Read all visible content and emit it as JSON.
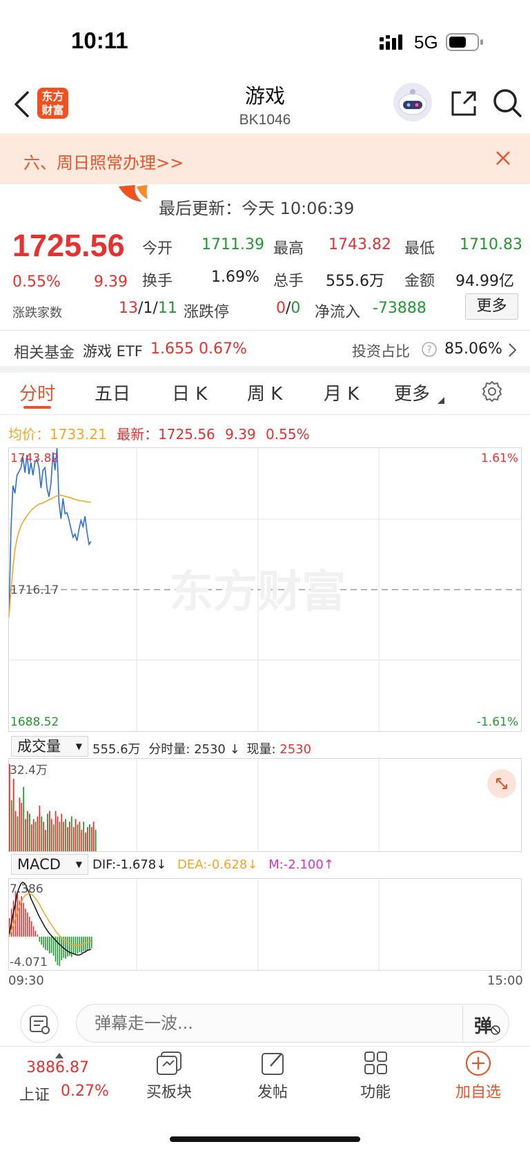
{
  "status_bar": {
    "time": "10:11",
    "network": "5G"
  },
  "header": {
    "logo_line1": "东方",
    "logo_line2": "财富",
    "title": "游戏",
    "code": "BK1046"
  },
  "notice": {
    "text": "六、周日照常办理>>"
  },
  "update": {
    "text": "最后更新：今天 10:06:39"
  },
  "quote": {
    "price": "1725.56",
    "change_pct": "0.55%",
    "change": "9.39",
    "open_label": "今开",
    "open": "1711.39",
    "high_label": "最高",
    "high": "1743.82",
    "low_label": "最低",
    "low": "1710.83",
    "turnover_label": "换手",
    "turnover": "1.69%",
    "volume_label": "总手",
    "volume": "555.6万",
    "amount_label": "金额",
    "amount": "94.99亿",
    "adv_label": "涨跌家数",
    "adv_up": "13",
    "adv_flat": "1",
    "adv_down": "11",
    "slash": "/",
    "limit_label": "涨跌停",
    "limit_up": "0",
    "limit_down": "0",
    "netflow_label": "净流入",
    "netflow": "-73888",
    "more_label": "更多"
  },
  "fund": {
    "label": "相关基金",
    "name": "游戏 ETF",
    "price": "1.655",
    "pct": "0.67%",
    "ratio_label": "投资占比",
    "ratio": "85.06%"
  },
  "tabs": [
    {
      "label": "分时"
    },
    {
      "label": "五日"
    },
    {
      "label": "日 K"
    },
    {
      "label": "周 K"
    },
    {
      "label": "月 K"
    },
    {
      "label": "更多"
    }
  ],
  "intraday": {
    "avg_label": "均价：",
    "avg": "1733.21",
    "latest_label": "最新：",
    "latest": "1725.56",
    "latest_chg": "9.39",
    "latest_pct": "0.55%",
    "y_top": "1743.82",
    "y_mid": "1716.17",
    "y_bottom": "1688.52",
    "pct_top": "1.61%",
    "pct_bottom": "-1.61%",
    "watermark": "东方财富"
  },
  "volume_panel": {
    "select": "成交量",
    "total": "555.6万",
    "min_label": "分时量:",
    "min_value": "2530",
    "now_label": "现量:",
    "now_value": "2530",
    "y_max": "32.4万"
  },
  "macd_panel": {
    "select": "MACD",
    "dif": "DIF:-1.678",
    "dea": "DEA:-0.628",
    "m": "M:-2.100",
    "y_max": "7.386",
    "y_min": "-4.071",
    "t_start": "09:30",
    "t_end": "15:00"
  },
  "comment": {
    "placeholder": "弹幕走一波...",
    "danmu_button": "弹"
  },
  "bottom_nav": {
    "index_value": "3886.87",
    "index_name": "上证",
    "index_pct": "0.27%",
    "items": [
      {
        "label": "买板块"
      },
      {
        "label": "发帖"
      },
      {
        "label": "功能"
      },
      {
        "label": "加自选"
      }
    ]
  },
  "colors": {
    "accent": "#e8552b",
    "up": "#e8312f",
    "down": "#1e9b2f",
    "price_line": "#2a6ed6",
    "avg_line": "#f5a623"
  },
  "chart_data": [
    {
      "type": "line",
      "title": "",
      "ylim": [
        1688.52,
        1743.82
      ],
      "series": [
        {
          "values": [
            1710.8,
            1728,
            1736.5,
            1735,
            1738.5,
            1739.2,
            1740,
            1742,
            1739,
            1742.5,
            1738.7,
            1741,
            1738.5,
            1741.2,
            1741.6,
            1740,
            1736,
            1739.5,
            1740,
            1736,
            1734.3,
            1737,
            1743,
            1739.5,
            1743.8,
            1733.2,
            1730,
            1734,
            1731,
            1731.2,
            1729.8,
            1728,
            1726.4,
            1727,
            1725.7,
            1728,
            1729.7,
            1728.5,
            1730.5,
            1727.4,
            1725,
            1725.6
          ]
        },
        {
          "values": [
            1710.8,
            1716,
            1720.5,
            1724,
            1726,
            1727.5,
            1728.6,
            1729.4,
            1730,
            1730.6,
            1731.1,
            1731.6,
            1732,
            1732.3,
            1732.6,
            1732.9,
            1733,
            1733.1,
            1733.3,
            1733.5,
            1733.7,
            1733.9,
            1734.1,
            1734.3,
            1734.5,
            1734.6,
            1734.6,
            1734.5,
            1734.4,
            1734.3,
            1734.2,
            1734.1,
            1733.9,
            1733.8,
            1733.7,
            1733.6,
            1733.5,
            1733.5,
            1733.4,
            1733.3,
            1733.3,
            1733.2
          ]
        }
      ]
    },
    {
      "type": "bar",
      "title": "",
      "ylim": [
        0,
        32.4
      ],
      "series": [
        {
          "values": [
            32.4,
            19,
            27,
            15,
            13,
            20,
            18,
            24,
            12,
            15,
            14,
            10,
            12,
            11,
            13,
            17,
            13,
            11,
            8,
            14,
            15,
            12,
            10,
            15,
            13,
            11,
            14,
            11,
            12,
            9,
            11,
            13,
            9,
            12,
            10,
            11,
            8,
            11,
            7,
            9,
            10,
            9,
            11,
            8
          ]
        }
      ]
    },
    {
      "type": "bar",
      "title": "",
      "ylim": [
        -4.071,
        7.386
      ],
      "series": [
        {
          "values": [
            2.5,
            3.8,
            4.9,
            6.2,
            5.8,
            4.9,
            5.5,
            4.6,
            3.8,
            3.3,
            2.7,
            2.1,
            1.4,
            0.8,
            0.3,
            -0.7,
            -1.1,
            -1.5,
            -1.8,
            -1.9,
            -2.3,
            -2.2,
            -2.6,
            -3.4,
            -3.9,
            -4.0,
            -3.2,
            -2.9,
            -3.0,
            -2.7,
            -2.6,
            -2.8,
            -2.4,
            -2.4,
            -2.3,
            -2.1,
            -2.2,
            -2.0,
            -2.0,
            -1.9,
            -1.7,
            -1.6
          ]
        },
        {
          "values": [
            0.2,
            1.5,
            3,
            4.2,
            5.8,
            6.6,
            7.2,
            7.4,
            7.2,
            6.6,
            6,
            5.2,
            4.6,
            4,
            3.4,
            2.8,
            2.3,
            1.8,
            1.3,
            0.9,
            0.5,
            0.2,
            -0.1,
            -0.4,
            -0.7,
            -1.0,
            -1.2,
            -1.5,
            -1.7,
            -1.9,
            -2.1,
            -2.2,
            -2.3,
            -2.4,
            -2.5,
            -2.5,
            -2.4,
            -2.2,
            -2.1,
            -1.9,
            -1.8,
            -1.7
          ]
        },
        {
          "values": [
            0.1,
            0.6,
            1.4,
            2.2,
            3.1,
            3.9,
            4.6,
            5.2,
            5.6,
            5.8,
            5.9,
            5.8,
            5.6,
            5.3,
            4.9,
            4.5,
            4.0,
            3.5,
            3.0,
            2.6,
            2.1,
            1.7,
            1.3,
            0.9,
            0.5,
            0.2,
            -0.1,
            -0.3,
            -0.5,
            -0.7,
            -0.9,
            -1.0,
            -1.1,
            -1.2,
            -1.2,
            -1.2,
            -1.1,
            -1.0,
            -0.9,
            -0.8,
            -0.7,
            -0.6
          ]
        }
      ]
    }
  ]
}
